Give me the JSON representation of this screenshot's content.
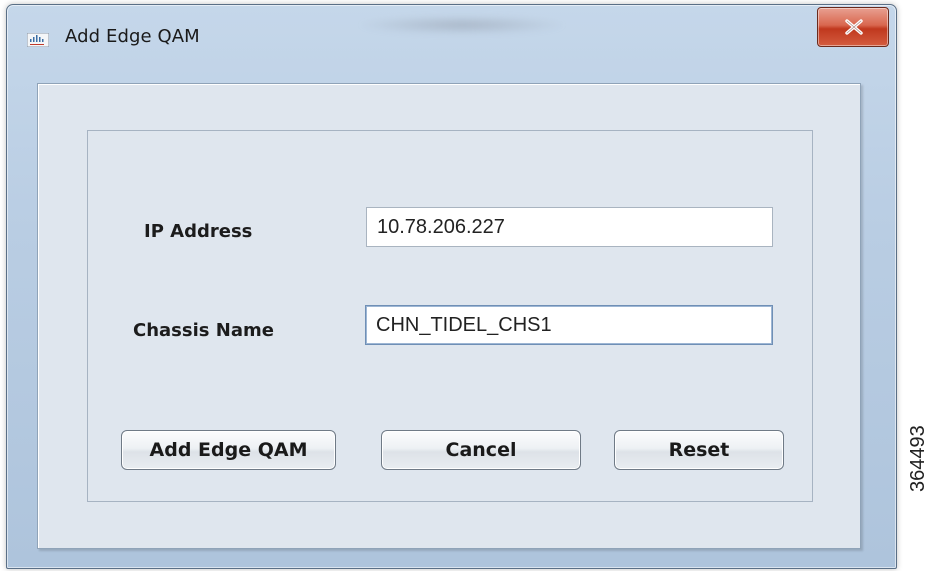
{
  "window": {
    "title": "Add Edge QAM",
    "icon": "cisco-app-icon",
    "close_icon": "close-x-icon"
  },
  "form": {
    "ip_address": {
      "label": "IP Address",
      "value": "10.78.206.227"
    },
    "chassis_name": {
      "label": "Chassis Name",
      "value": "CHN_TIDEL_CHS1"
    }
  },
  "buttons": {
    "add_label": "Add Edge QAM",
    "cancel_label": "Cancel",
    "reset_label": "Reset"
  },
  "figure_id": "364493",
  "colors": {
    "close_button": "#c0381e",
    "frame": "#b9cde3",
    "client_background": "#dfe6ee"
  }
}
